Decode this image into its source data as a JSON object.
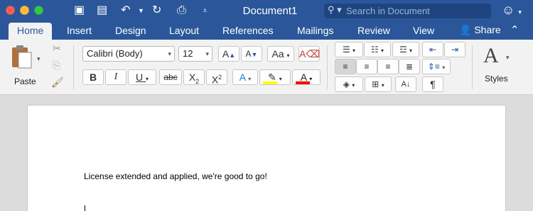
{
  "window": {
    "title": "Document1",
    "search_placeholder": "Search in Document"
  },
  "tabs": [
    {
      "label": "Home",
      "active": true
    },
    {
      "label": "Insert"
    },
    {
      "label": "Design"
    },
    {
      "label": "Layout"
    },
    {
      "label": "References"
    },
    {
      "label": "Mailings"
    },
    {
      "label": "Review"
    },
    {
      "label": "View"
    }
  ],
  "share_label": "Share",
  "clipboard": {
    "paste_label": "Paste"
  },
  "font": {
    "family": "Calibri (Body)",
    "size": "12",
    "bold": "B",
    "italic": "I",
    "underline": "U",
    "strikethrough": "abc",
    "subscript": "X2",
    "superscript": "X2",
    "grow": "A",
    "shrink": "A",
    "case": "Aa",
    "text_effects": "A",
    "highlight": "A",
    "font_color": "A"
  },
  "styles_label": "Styles",
  "document": {
    "paragraph": "License extended and applied, we're good to go!"
  },
  "colors": {
    "brand": "#2b579a",
    "highlight": "#ffff00",
    "font_color": "#ff0000"
  }
}
